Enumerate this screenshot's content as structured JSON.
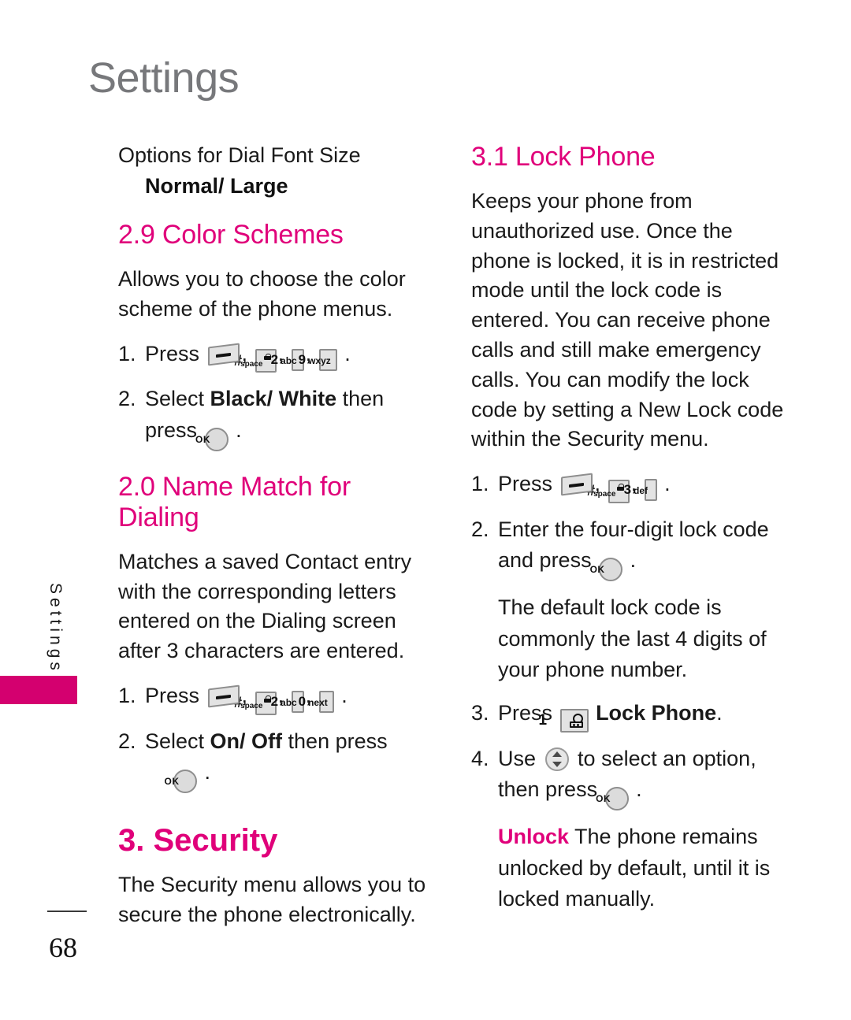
{
  "page": {
    "header_title": "Settings",
    "side_tab_label": "Settings",
    "page_number": "68"
  },
  "left_column": {
    "options_label": "Options for Dial Font Size",
    "options_values": "Normal/ Large",
    "section_color_schemes": {
      "heading": "2.9 Color Schemes",
      "body": "Allows you to choose the color scheme of the phone menus.",
      "step1_num": "1.",
      "step1_press": "Press",
      "step1_keys": [
        {
          "type": "soft",
          "name": "menu-soft-key"
        },
        {
          "type": "hash",
          "label": "#",
          "sub": "space"
        },
        {
          "type": "digit",
          "label": "2",
          "sub": "abc"
        },
        {
          "type": "digit",
          "label": "9",
          "sub": "wxyz"
        }
      ],
      "step2_num": "2.",
      "step2_before": "Select ",
      "step2_bold": "Black/ White",
      "step2_after": " then press",
      "step2_trailing": "."
    },
    "section_name_match": {
      "heading": "2.0 Name Match for Dialing",
      "body": "Matches a saved Contact entry with the corresponding letters entered on the Dialing screen after 3 characters are entered.",
      "step1_num": "1.",
      "step1_press": "Press",
      "step1_keys": [
        {
          "type": "soft",
          "name": "menu-soft-key"
        },
        {
          "type": "hash",
          "label": "#",
          "sub": "space"
        },
        {
          "type": "digit",
          "label": "2",
          "sub": "abc"
        },
        {
          "type": "digit",
          "label": "0",
          "sub": "next"
        }
      ],
      "step2_num": "2.",
      "step2_before": "Select ",
      "step2_bold": "On/ Off",
      "step2_after": " then press",
      "step2_trailing": "."
    },
    "section_security": {
      "heading": "3. Security",
      "body": "The Security menu allows you to secure the phone electronically."
    }
  },
  "right_column": {
    "section_lock_phone": {
      "heading": "3.1 Lock Phone",
      "body": "Keeps your phone from unauthorized use. Once the phone is locked, it is in restricted mode until the lock code is entered. You can receive phone calls and still make emergency calls. You can modify the lock code by setting a New Lock code within the Security menu.",
      "step1_num": "1.",
      "step1_press": "Press",
      "step1_keys": [
        {
          "type": "soft",
          "name": "menu-soft-key"
        },
        {
          "type": "hash",
          "label": "#",
          "sub": "space"
        },
        {
          "type": "digit",
          "label": "3",
          "sub": "def"
        }
      ],
      "step2_num": "2.",
      "step2_text": "Enter the four-digit lock code and press",
      "step2_trailing": ".",
      "step2_note": "The default lock code is commonly the last 4 digits of your phone number.",
      "step3_num": "3.",
      "step3_press": "Press",
      "step3_key": {
        "type": "one",
        "label": "1",
        "icon": "voicemail-icon"
      },
      "step3_bold": "Lock Phone",
      "step3_trailing": ".",
      "step4_num": "4.",
      "step4_use": "Use",
      "step4_nav_key": {
        "type": "nav",
        "name": "navigation-key"
      },
      "step4_text": "to select an option, then press",
      "step4_trailing": ".",
      "unlock_label": "Unlock",
      "unlock_body": " The phone remains unlocked by default, until it is locked manually."
    }
  },
  "colors": {
    "magenta": "#e0007a",
    "tab_magenta": "#d4006f",
    "header_gray": "#77787b",
    "body_black": "#1a1a1a"
  }
}
